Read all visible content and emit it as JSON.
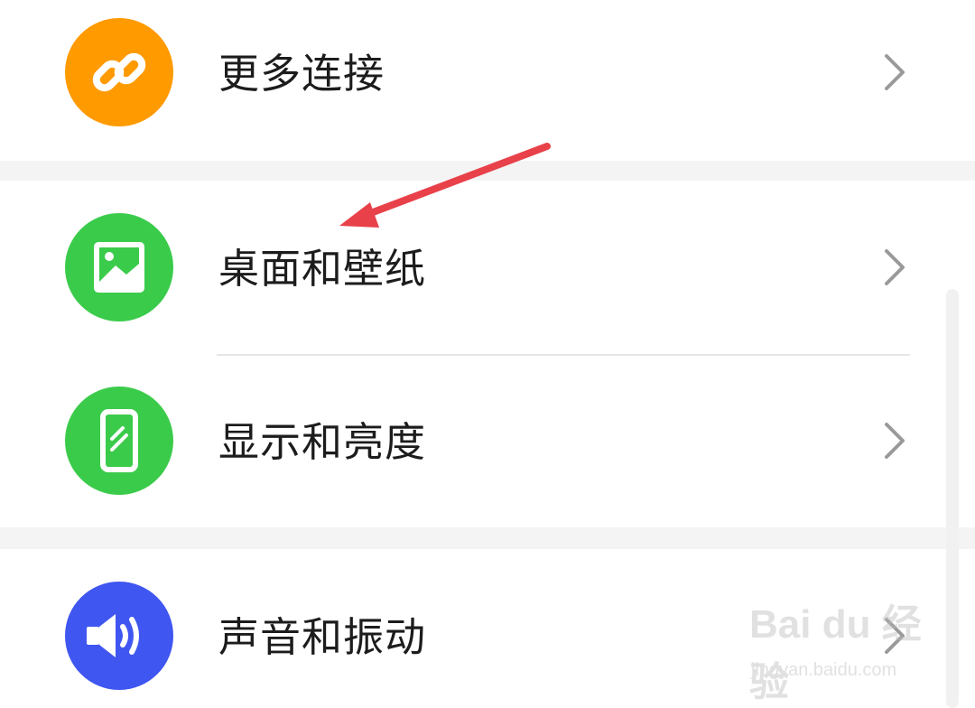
{
  "settings": {
    "items": [
      {
        "label": "更多连接",
        "icon": "link-icon",
        "color": "#FF9A00"
      },
      {
        "label": "桌面和壁纸",
        "icon": "image-icon",
        "color": "#3BCB4B"
      },
      {
        "label": "显示和亮度",
        "icon": "phone-brightness-icon",
        "color": "#3BCB4B"
      },
      {
        "label": "声音和振动",
        "icon": "speaker-icon",
        "color": "#3F56F0"
      }
    ]
  },
  "annotation": {
    "arrow_color": "#E8414A"
  },
  "watermark": {
    "brand": "Bai du 经验",
    "site": "jingyan.baidu.com"
  }
}
